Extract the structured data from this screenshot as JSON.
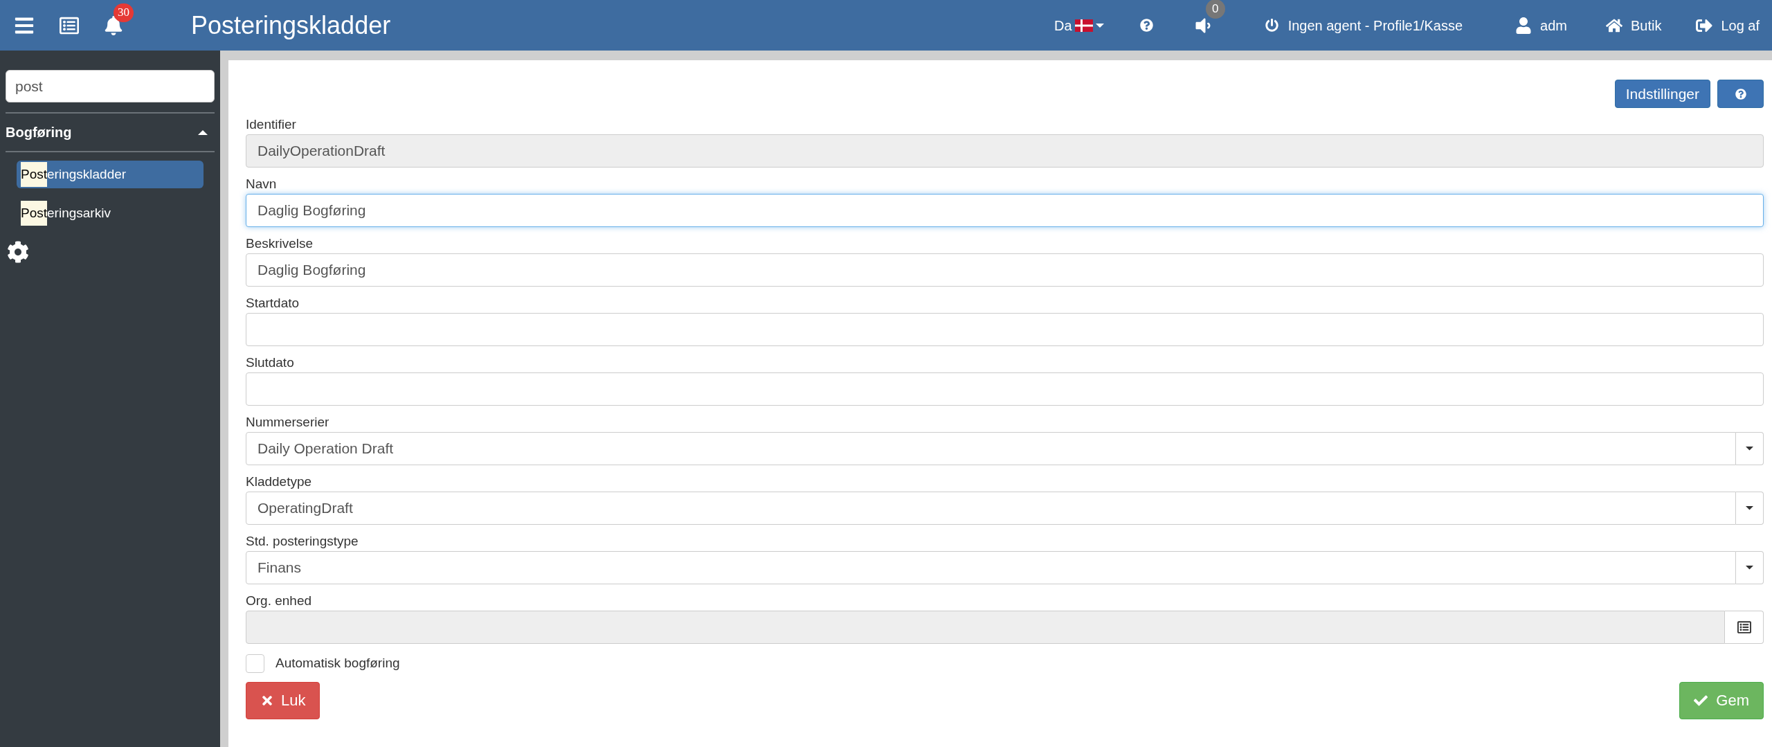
{
  "header": {
    "title": "Posteringskladder",
    "notifications_badge": "30",
    "language": "Da",
    "sound_badge": "0",
    "agent": "Ingen agent - Profile1/Kasse",
    "user": "adm",
    "shop": "Butik",
    "logout": "Log af"
  },
  "sidebar": {
    "search": {
      "value": "post"
    },
    "section": {
      "title": "Bogføring",
      "expanded": true,
      "items": [
        {
          "match": "Post",
          "rest": "eringskladder",
          "selected": true
        },
        {
          "match": "Post",
          "rest": "eringsarkiv",
          "selected": false
        }
      ]
    }
  },
  "toolbar": {
    "settings_button": "Indstillinger"
  },
  "fields": [
    {
      "label": "Identifier",
      "kind": "text",
      "value": "DailyOperationDraft",
      "disabled": true,
      "focused": false
    },
    {
      "label": "Navn",
      "kind": "text",
      "value": "Daglig Bogføring",
      "disabled": false,
      "focused": true
    },
    {
      "label": "Beskrivelse",
      "kind": "text",
      "value": "Daglig Bogføring",
      "disabled": false,
      "focused": false
    },
    {
      "label": "Startdato",
      "kind": "text",
      "disabled": false,
      "focused": false
    },
    {
      "label": "Slutdato",
      "kind": "text",
      "disabled": false,
      "focused": false
    },
    {
      "label": "Nummerserier",
      "kind": "select",
      "value": "Daily Operation Draft",
      "disabled": false,
      "focused": false
    },
    {
      "label": "Kladdetype",
      "kind": "select",
      "value": "OperatingDraft",
      "disabled": false,
      "focused": false
    },
    {
      "label": "Std. posteringstype",
      "kind": "select",
      "value": "Finans",
      "disabled": false,
      "focused": false
    },
    {
      "label": "Org. enhed",
      "kind": "lookup",
      "disabled": true,
      "focused": false
    }
  ],
  "checkbox": {
    "label": "Automatisk bogføring",
    "checked": false
  },
  "buttons": {
    "close": "Luk",
    "save": "Gem"
  }
}
